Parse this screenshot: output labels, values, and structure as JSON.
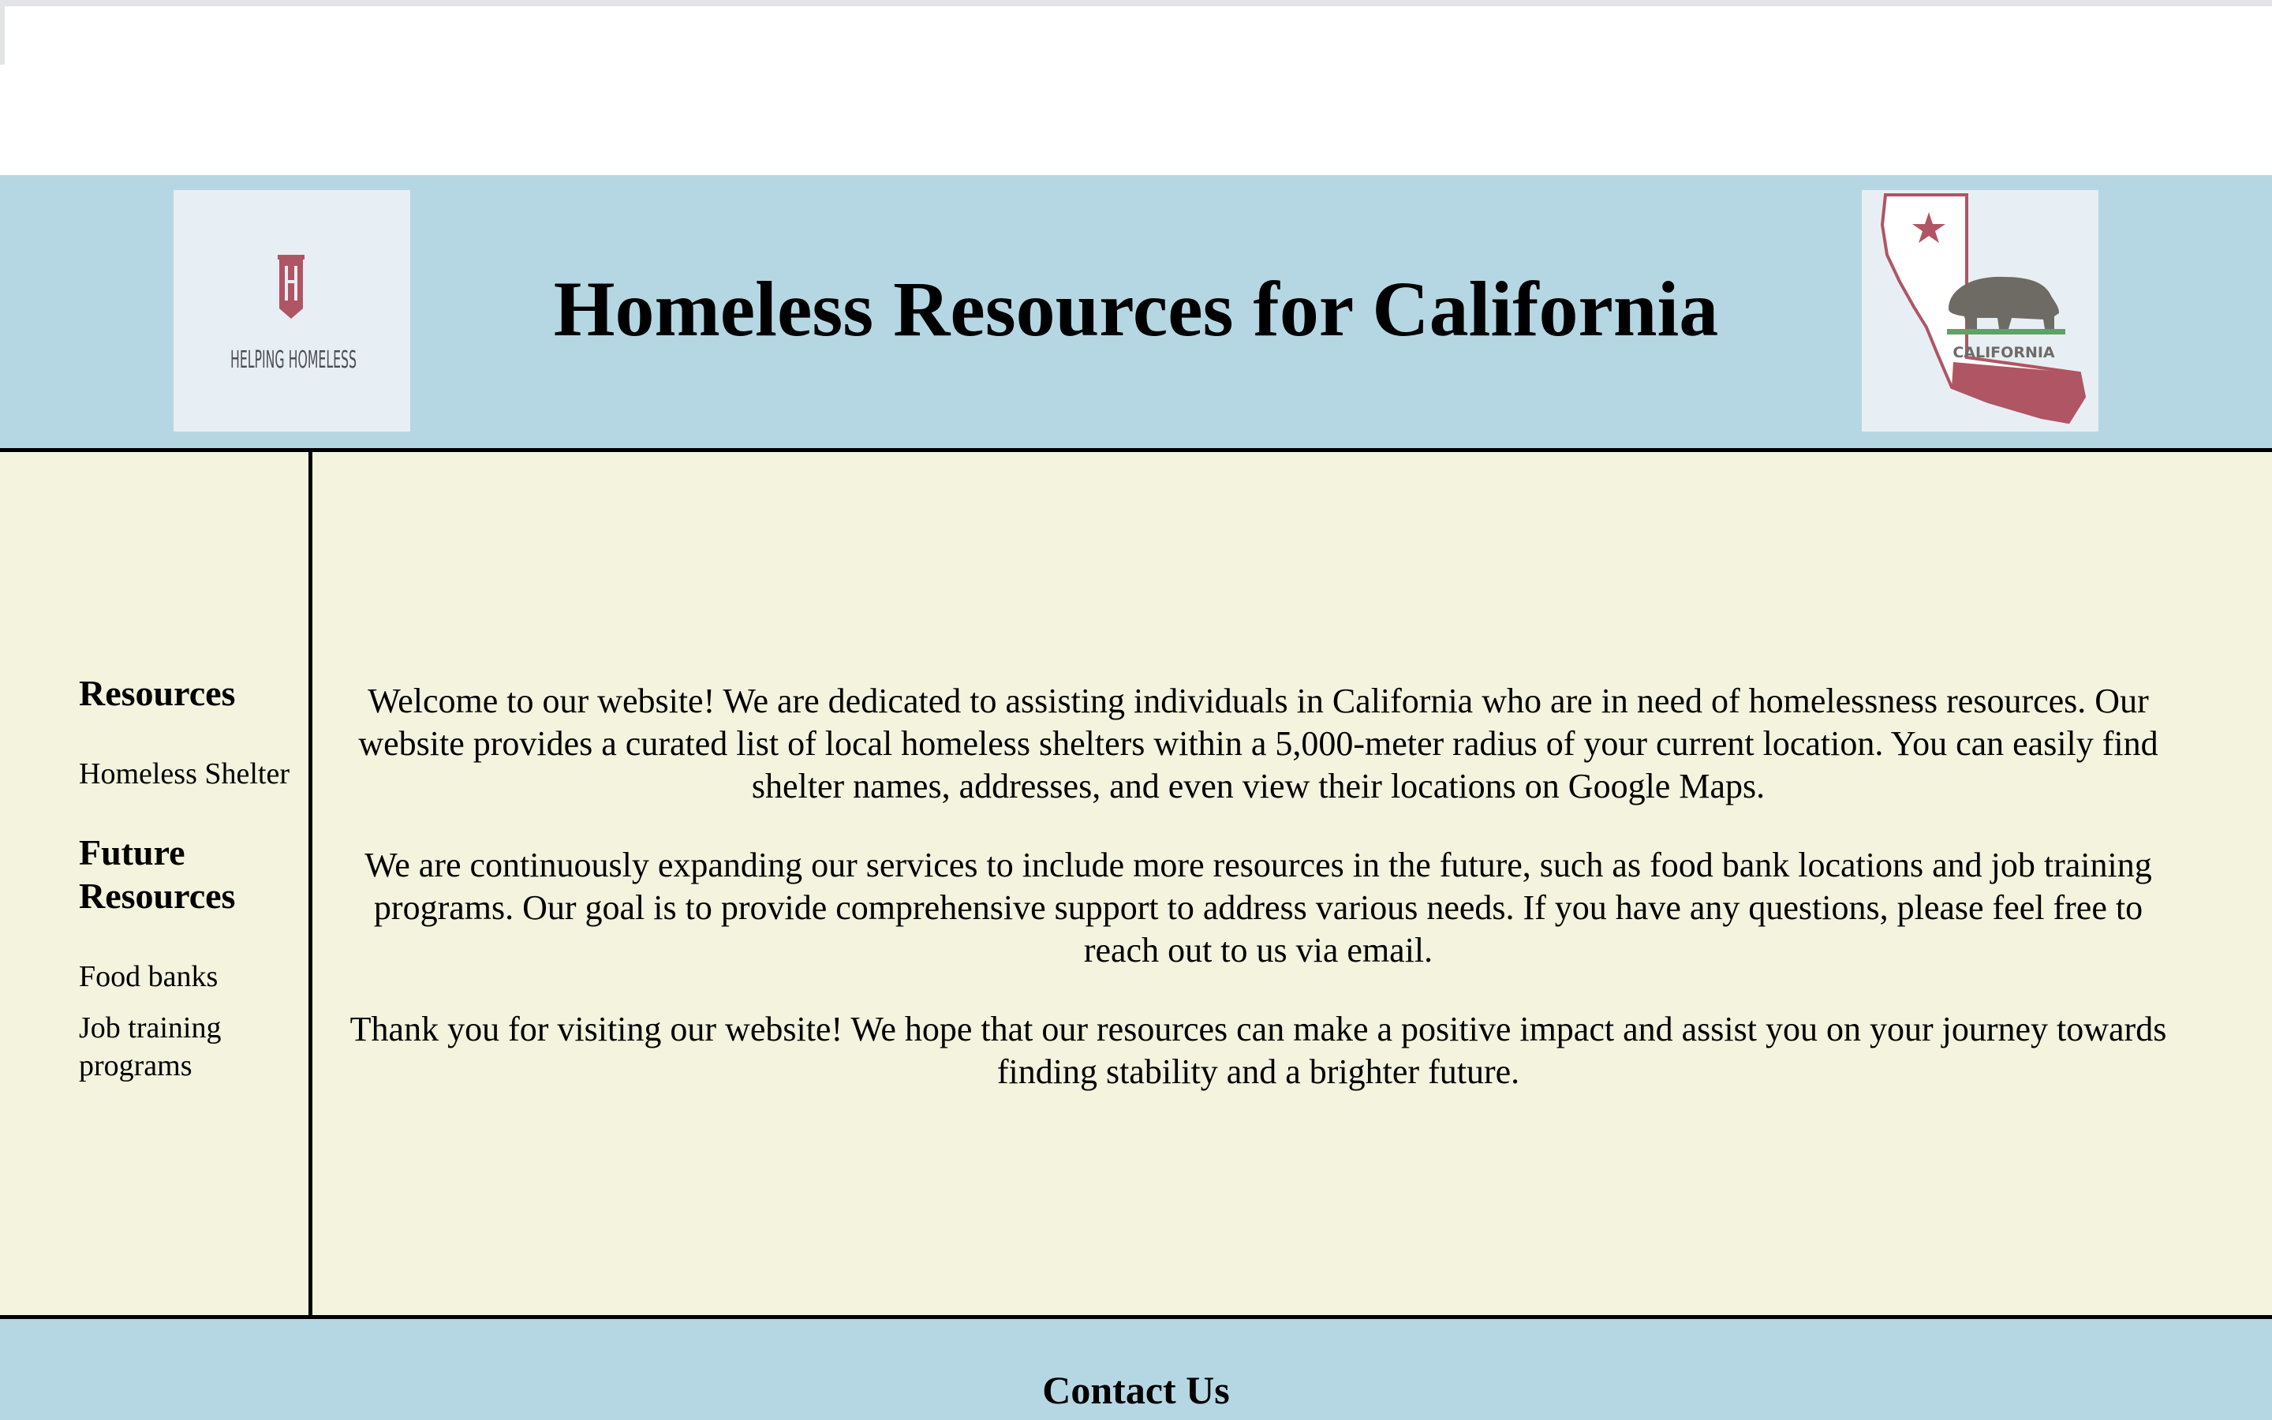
{
  "header": {
    "title": "Homeless Resources for California",
    "left_logo": {
      "text": "HELPING HOMELESS",
      "icon": "helping-homeless-logo"
    },
    "right_logo": {
      "text": "CALIFORNIA",
      "icon": "california-state-bear-logo"
    }
  },
  "sidebar": {
    "resources_heading": "Resources",
    "resources_items": [
      "Homeless Shelter"
    ],
    "future_heading_line1": "Future",
    "future_heading_line2": "Resources",
    "future_items": [
      "Food banks",
      "Job training",
      "programs"
    ]
  },
  "content": {
    "paragraph1": "Welcome to our website! We are dedicated to assisting individuals in California who are in need of homelessness resources. Our website provides a curated list of local homeless shelters within a 5,000-meter radius of your current location. You can easily find shelter names, addresses, and even view their locations on Google Maps.",
    "paragraph2": "We are continuously expanding our services to include more resources in the future, such as food bank locations and job training programs. Our goal is to provide comprehensive support to address various needs. If you have any questions, please feel free to reach out to us via email.",
    "paragraph3": "Thank you for visiting our website! We hope that our resources can make a positive impact and assist you on your journey towards finding stability and a brighter future."
  },
  "footer": {
    "heading": "Contact Us"
  },
  "colors": {
    "header_bg": "#b5d7e3",
    "main_bg": "#f3f3de",
    "logo_red": "#b05563",
    "bear_gray": "#6e6b64"
  }
}
